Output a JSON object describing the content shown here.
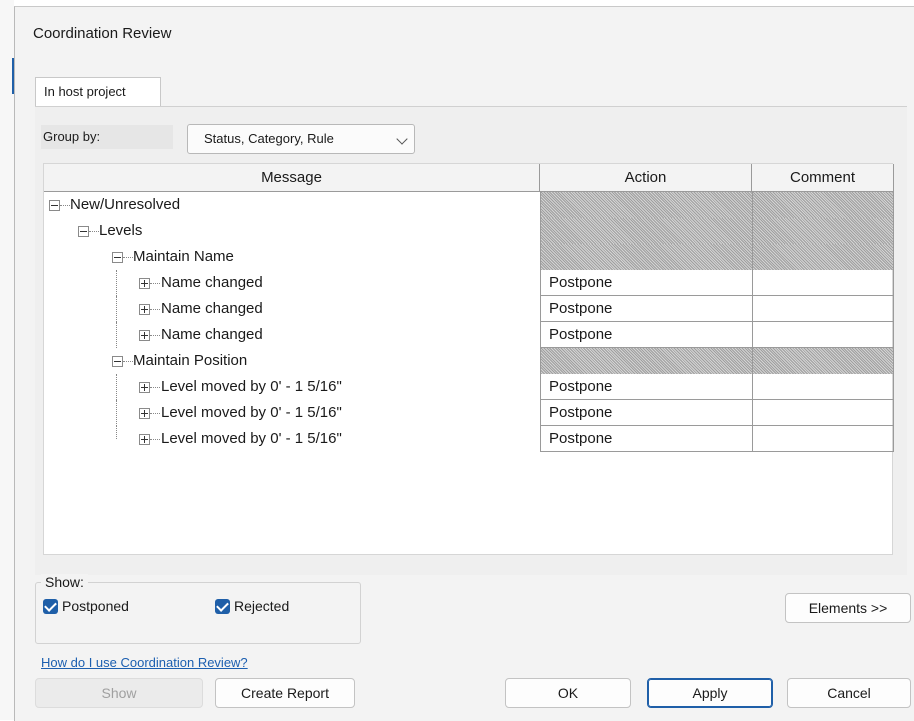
{
  "dialog": {
    "title": "Coordination Review"
  },
  "tab": {
    "label": "In host project"
  },
  "group_by": {
    "label": "Group by:",
    "value": "Status, Category, Rule"
  },
  "grid": {
    "headers": {
      "message": "Message",
      "action": "Action",
      "comment": "Comment"
    },
    "rows": [
      {
        "label": "New/Unresolved",
        "action": "",
        "comment": ""
      },
      {
        "label": "Levels",
        "action": "",
        "comment": ""
      },
      {
        "label": "Maintain Name",
        "action": "",
        "comment": ""
      },
      {
        "label": "Name changed",
        "action": "Postpone",
        "comment": ""
      },
      {
        "label": "Name changed",
        "action": "Postpone",
        "comment": ""
      },
      {
        "label": "Name changed",
        "action": "Postpone",
        "comment": ""
      },
      {
        "label": "Maintain Position",
        "action": "",
        "comment": ""
      },
      {
        "label": "Level moved by 0' - 1 5/16\"",
        "action": "Postpone",
        "comment": ""
      },
      {
        "label": "Level moved by 0' - 1 5/16\"",
        "action": "Postpone",
        "comment": ""
      },
      {
        "label": "Level moved by 0' - 1 5/16\"",
        "action": "Postpone",
        "comment": ""
      }
    ]
  },
  "show_group": {
    "legend": "Show:",
    "postponed": {
      "label": "Postponed",
      "checked": true
    },
    "rejected": {
      "label": "Rejected",
      "checked": true
    }
  },
  "buttons": {
    "elements": "Elements >>",
    "show": "Show",
    "create_report": "Create Report",
    "ok": "OK",
    "apply": "Apply",
    "cancel": "Cancel"
  },
  "help_link": "How do I use Coordination Review?",
  "colors": {
    "accent": "#1f5fa8",
    "link": "#1c5fb0"
  }
}
